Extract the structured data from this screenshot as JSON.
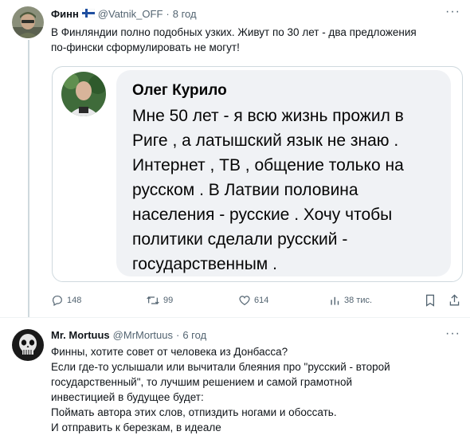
{
  "tweet1": {
    "author_name": "Финн",
    "author_flag": "🇫🇮",
    "handle": "@Vatnik_OFF",
    "separator": "·",
    "time": "8 год",
    "more": "···",
    "text_lines": [
      "В Финляндии полно подобных узких. Живут по 30 лет - два предложения",
      "по-фински сформулировать не могут!"
    ],
    "embed": {
      "name": "Олег Курило",
      "lines": [
        "Мне 50 лет - я всю жизнь прожил в",
        "Риге , а латышский язык не знаю .",
        "Интернет , ТВ , общение только на",
        "русском . В Латвии половина",
        "населения - русские . Хочу чтобы",
        "политики сделали русский -",
        "государственным ."
      ]
    },
    "actions": {
      "replies": "148",
      "retweets": "99",
      "likes": "614",
      "views": "38 тис."
    }
  },
  "tweet2": {
    "author_name": "Mr. Mortuus",
    "handle": "@MrMortuus",
    "separator": "·",
    "time": "6 год",
    "more": "···",
    "text_lines": [
      "Финны, хотите совет от человека из Донбасса?",
      "Если где-то услышали или вычитали блеяния про \"русский - второй",
      "государственный\", то лучшим решением и самой грамотной",
      "инвестицией в будущее будет:",
      "Поймать автора этих слов, отпиздить ногами и обоссать.",
      "И отправить к березкам, в идеале"
    ]
  },
  "colors": {
    "text": "#0f1419",
    "secondary": "#536471",
    "border": "#cfd9de",
    "bubble": "#f0f2f5"
  }
}
